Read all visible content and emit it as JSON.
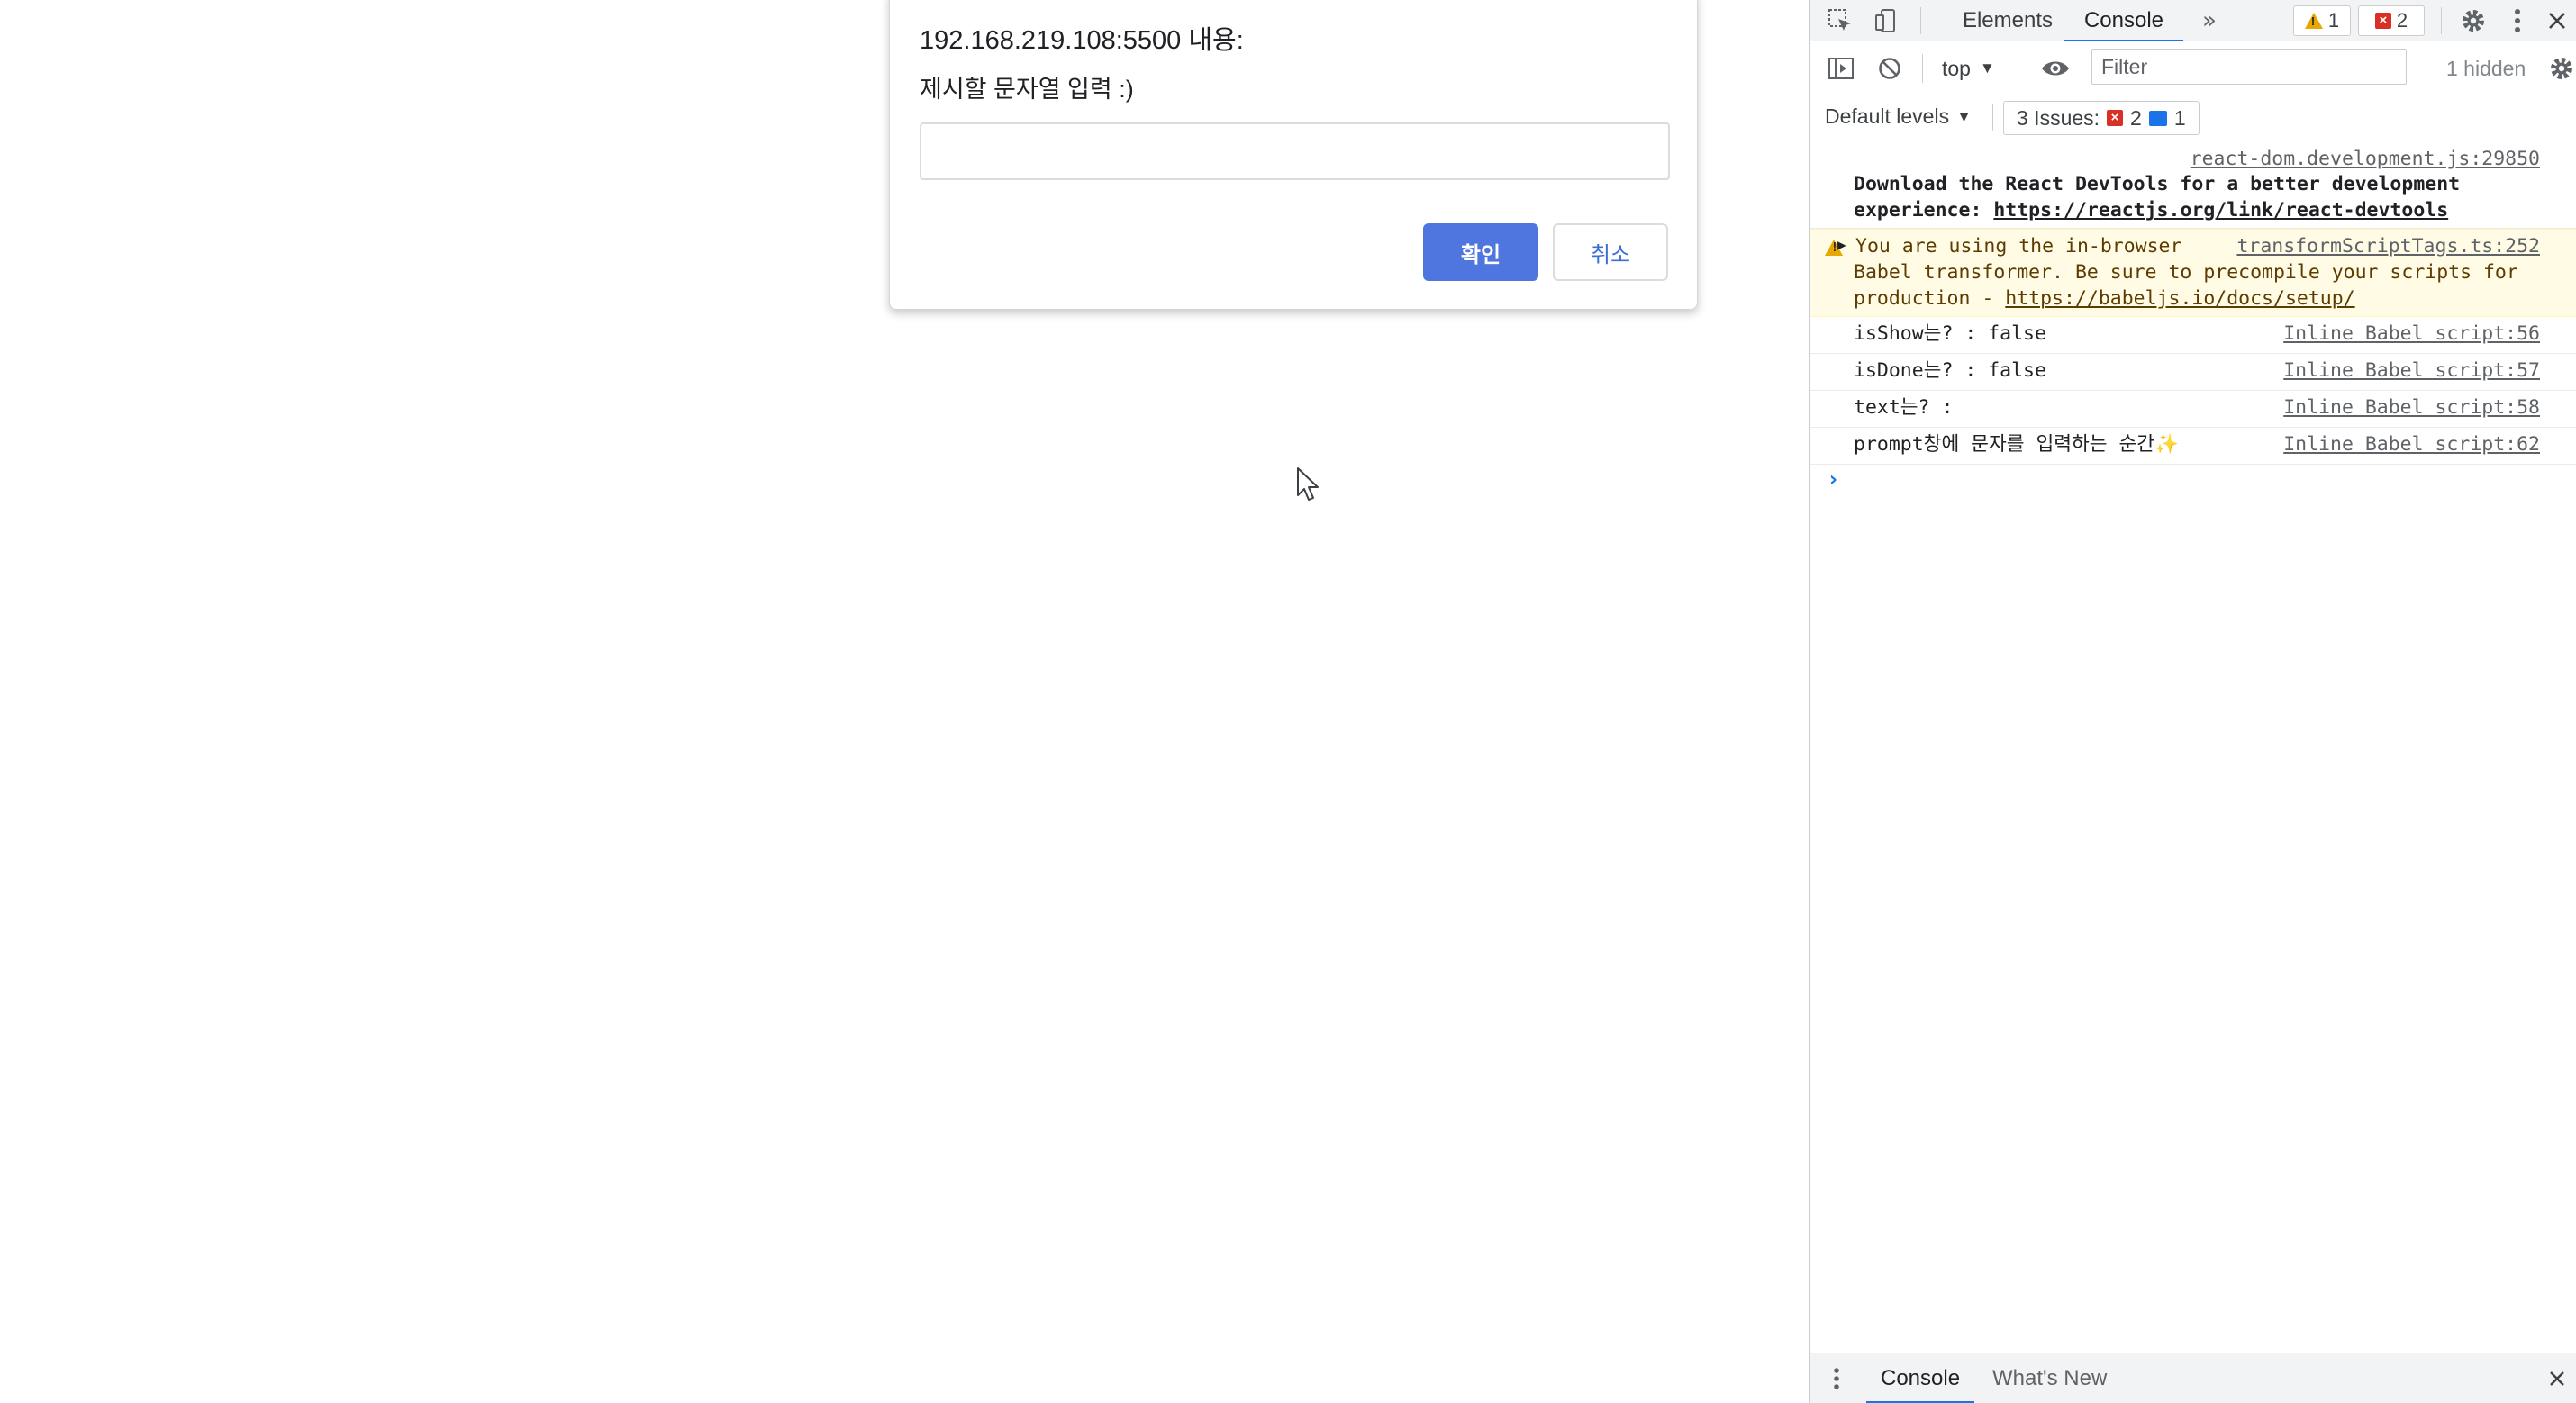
{
  "dialog": {
    "origin": "192.168.219.108:5500 내용:",
    "message": "제시할 문자열 입력 :)",
    "input_value": "",
    "ok_label": "확인",
    "cancel_label": "취소"
  },
  "devtools": {
    "tabs": [
      {
        "label": "Elements",
        "active": false
      },
      {
        "label": "Console",
        "active": true
      }
    ],
    "more_tabs_icon": "chevron-double-right-icon",
    "warning_count": "1",
    "error_count": "2",
    "context": "top",
    "filter_placeholder": "Filter",
    "hidden_count": "1 hidden",
    "levels_label": "Default levels",
    "issues": {
      "label": "3 Issues:",
      "errors": "2",
      "info": "1"
    },
    "messages": [
      {
        "source": "react-dom.development.js:29850",
        "line1": "Download the React DevTools for a better development",
        "line2_prefix": "experience: ",
        "link": "https://reactjs.org/link/react-devtools"
      },
      {
        "level": "warning",
        "source": "transformScriptTags.ts:252",
        "line1": "You are using the in-browser",
        "line2": "Babel transformer. Be sure to precompile your scripts for",
        "line3_prefix": "production - ",
        "link": "https://babeljs.io/docs/setup/"
      },
      {
        "text": "isShow는? : false",
        "source": "Inline Babel script:56"
      },
      {
        "text": "isDone는? : false",
        "source": "Inline Babel script:57"
      },
      {
        "text": "text는? :",
        "source": "Inline Babel script:58"
      },
      {
        "text": "prompt창에 문자를 입력하는 순간✨",
        "source": "Inline Babel script:62"
      }
    ],
    "drawer_tabs": [
      {
        "label": "Console",
        "active": true
      },
      {
        "label": "What's New",
        "active": false
      }
    ]
  },
  "colors": {
    "accent": "#1a73e8",
    "ok_button": "#4f76df",
    "error": "#d93025",
    "warning": "#e6a700"
  }
}
